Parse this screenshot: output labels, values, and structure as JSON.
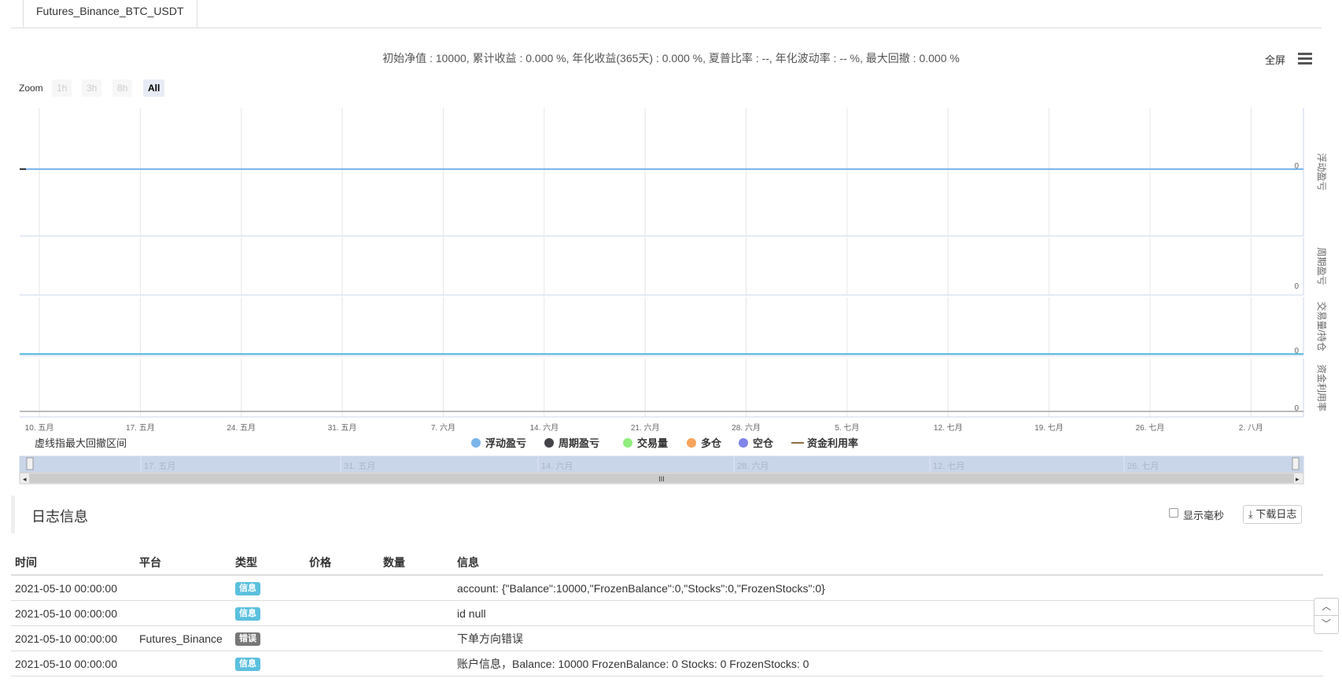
{
  "tab": {
    "label": "Futures_Binance_BTC_USDT"
  },
  "summary": "初始净值 : 10000, 累计收益 : 0.000 %, 年化收益(365天) : 0.000 %, 夏普比率 : --, 年化波动率 : -- %, 最大回撤 : 0.000 %",
  "toolbar": {
    "fullscreen_label": "全屏",
    "menu_icon": "hamburger-menu-icon"
  },
  "zoom": {
    "label": "Zoom",
    "buttons": [
      "1h",
      "3h",
      "8h",
      "All"
    ],
    "active": "All"
  },
  "chart_data": {
    "type": "line",
    "x_ticks": [
      "10. 五月",
      "17. 五月",
      "24. 五月",
      "31. 五月",
      "7. 六月",
      "14. 六月",
      "21. 六月",
      "28. 六月",
      "5. 七月",
      "12. 七月",
      "19. 七月",
      "26. 七月",
      "2. 八月"
    ],
    "x_range": [
      "2021-05-10",
      "2021-08-07"
    ],
    "panels": [
      {
        "title": "浮动盈亏",
        "y_tick": "0",
        "values": [
          0,
          0
        ]
      },
      {
        "title": "周期盈亏",
        "y_tick": "0",
        "values": []
      },
      {
        "title": "交易量/持仓",
        "y_tick": "0",
        "values": [
          0,
          0
        ]
      },
      {
        "title": "资金利用率",
        "y_tick": "0",
        "values": [
          0,
          0
        ]
      }
    ],
    "legend": [
      {
        "name": "浮动盈亏",
        "color": "#7cb5ec",
        "marker": "circle"
      },
      {
        "name": "周期盈亏",
        "color": "#434348",
        "marker": "circle"
      },
      {
        "name": "交易量",
        "color": "#90ed7d",
        "marker": "circle"
      },
      {
        "name": "多仓",
        "color": "#f7a35c",
        "marker": "circle"
      },
      {
        "name": "空仓",
        "color": "#8085e9",
        "marker": "circle"
      },
      {
        "name": "资金利用率",
        "color": "#8d6e3f",
        "marker": "line"
      }
    ],
    "legend_note": "虚线指最大回撤区间",
    "navigator_ticks": [
      "17. 五月",
      "31. 五月",
      "14. 六月",
      "28. 六月",
      "12. 七月",
      "26. 七月"
    ],
    "grid": true
  },
  "log": {
    "title": "日志信息",
    "show_ms_label": "显示毫秒",
    "download_label": "下载日志",
    "columns": [
      "时间",
      "平台",
      "类型",
      "价格",
      "数量",
      "信息"
    ],
    "rows": [
      {
        "time": "2021-05-10 00:00:00",
        "platform": "",
        "type": "信息",
        "type_kind": "info",
        "price": "",
        "qty": "",
        "msg": "account: {\"Balance\":10000,\"FrozenBalance\":0,\"Stocks\":0,\"FrozenStocks\":0}"
      },
      {
        "time": "2021-05-10 00:00:00",
        "platform": "",
        "type": "信息",
        "type_kind": "info",
        "price": "",
        "qty": "",
        "msg": "id null"
      },
      {
        "time": "2021-05-10 00:00:00",
        "platform": "Futures_Binance",
        "type": "错误",
        "type_kind": "error",
        "price": "",
        "qty": "",
        "msg": "下单方向错误"
      },
      {
        "time": "2021-05-10 00:00:00",
        "platform": "",
        "type": "信息",
        "type_kind": "info",
        "price": "",
        "qty": "",
        "msg": "账户信息，Balance: 10000 FrozenBalance: 0 Stocks: 0 FrozenStocks: 0"
      }
    ]
  }
}
